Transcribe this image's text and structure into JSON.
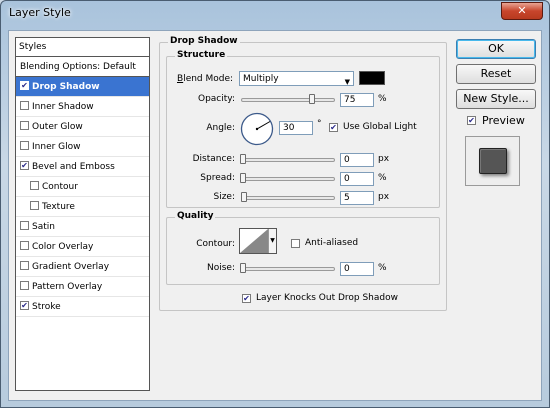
{
  "window": {
    "title": "Layer Style"
  },
  "styles_list": {
    "header": "Styles",
    "blending": "Blending Options: Default",
    "items": [
      {
        "label": "Drop Shadow",
        "checked": true,
        "selected": true,
        "sub": false
      },
      {
        "label": "Inner Shadow",
        "checked": false,
        "selected": false,
        "sub": false
      },
      {
        "label": "Outer Glow",
        "checked": false,
        "selected": false,
        "sub": false
      },
      {
        "label": "Inner Glow",
        "checked": false,
        "selected": false,
        "sub": false
      },
      {
        "label": "Bevel and Emboss",
        "checked": true,
        "selected": false,
        "sub": false
      },
      {
        "label": "Contour",
        "checked": false,
        "selected": false,
        "sub": true
      },
      {
        "label": "Texture",
        "checked": false,
        "selected": false,
        "sub": true
      },
      {
        "label": "Satin",
        "checked": false,
        "selected": false,
        "sub": false
      },
      {
        "label": "Color Overlay",
        "checked": false,
        "selected": false,
        "sub": false
      },
      {
        "label": "Gradient Overlay",
        "checked": false,
        "selected": false,
        "sub": false
      },
      {
        "label": "Pattern Overlay",
        "checked": false,
        "selected": false,
        "sub": false
      },
      {
        "label": "Stroke",
        "checked": true,
        "selected": false,
        "sub": false
      }
    ]
  },
  "drop_shadow": {
    "title": "Drop Shadow",
    "structure": {
      "title": "Structure",
      "blend_mode_label": "Blend Mode:",
      "blend_mode_value": "Multiply",
      "shadow_color": "#000000",
      "opacity_label": "Opacity:",
      "opacity_value": "75",
      "opacity_fraction": 0.75,
      "opacity_unit": "%",
      "angle_label": "Angle:",
      "angle_value": "30",
      "angle_unit": "°",
      "use_global_light_label": "Use Global Light",
      "use_global_light_checked": true,
      "distance_label": "Distance:",
      "distance_value": "0",
      "distance_unit": "px",
      "spread_label": "Spread:",
      "spread_value": "0",
      "spread_unit": "%",
      "size_label": "Size:",
      "size_value": "5",
      "size_unit": "px"
    },
    "quality": {
      "title": "Quality",
      "contour_label": "Contour:",
      "anti_aliased_label": "Anti-aliased",
      "anti_aliased_checked": false,
      "noise_label": "Noise:",
      "noise_value": "0",
      "noise_unit": "%"
    },
    "knockout_label": "Layer Knocks Out Drop Shadow",
    "knockout_checked": true
  },
  "buttons": {
    "ok": "OK",
    "reset": "Reset",
    "new_style": "New Style...",
    "preview_label": "Preview",
    "preview_checked": true
  },
  "colors": {
    "selection": "#3a74d1",
    "preview_fill": "#555555"
  }
}
